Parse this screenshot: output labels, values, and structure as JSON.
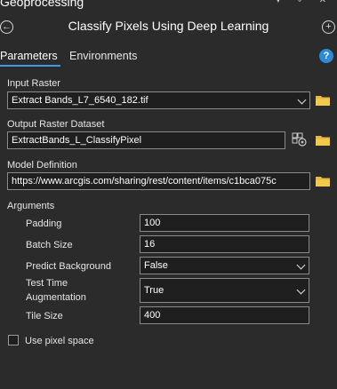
{
  "pane": {
    "title": "Geoprocessing",
    "controls": "▾ ⌖ ✕"
  },
  "tool": {
    "title": "Classify Pixels Using Deep Learning"
  },
  "tabs": [
    {
      "label": "Parameters",
      "active": true
    },
    {
      "label": "Environments",
      "active": false
    }
  ],
  "params": {
    "input_raster": {
      "label": "Input Raster",
      "value": "Extract Bands_L7_6540_182.tif"
    },
    "output_raster": {
      "label": "Output Raster Dataset",
      "value": "ExtractBands_L_ClassifyPixel"
    },
    "model_definition": {
      "label": "Model Definition",
      "value": "https://www.arcgis.com/sharing/rest/content/items/c1bca075c"
    }
  },
  "arguments": {
    "heading": "Arguments",
    "padding": {
      "label": "Padding",
      "value": "100"
    },
    "batch_size": {
      "label": "Batch Size",
      "value": "16"
    },
    "predict_background": {
      "label": "Predict Background",
      "value": "False"
    },
    "test_time_augmentation": {
      "label_line1": "Test Time",
      "label_line2": "Augmentation",
      "value": "True"
    },
    "tile_size": {
      "label": "Tile Size",
      "value": "400"
    }
  },
  "use_pixel_space": {
    "label": "Use pixel space",
    "checked": false
  },
  "icons": {
    "back": "back-arrow-icon",
    "add": "plus-icon",
    "help": "help-icon",
    "folder": "folder-icon",
    "env": "raster-env-icon"
  },
  "colors": {
    "accent": "#3d9be9",
    "folder": "#e8b93b",
    "background": "#2b2b2b"
  }
}
